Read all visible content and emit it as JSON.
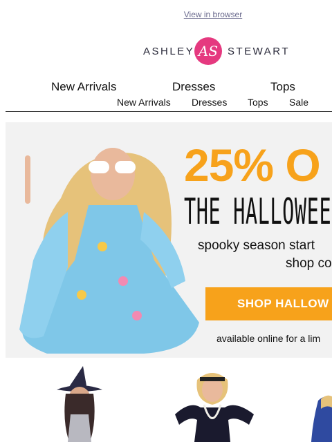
{
  "header": {
    "view_in_browser": "View in browser"
  },
  "logo": {
    "left_word": "ASHLEY",
    "right_word": "STEWART",
    "monogram": "AS",
    "brand_color": "#e5397f"
  },
  "nav_primary": [
    {
      "label": "New Arrivals"
    },
    {
      "label": "Dresses"
    },
    {
      "label": "Tops"
    }
  ],
  "nav_secondary": [
    {
      "label": "New Arrivals"
    },
    {
      "label": "Dresses"
    },
    {
      "label": "Tops"
    },
    {
      "label": "Sale"
    }
  ],
  "hero": {
    "headline": "25% O",
    "title": "THE HALLOWEEN",
    "line1": "spooky season start",
    "line2": "shop co",
    "cta_label": "SHOP HALLOW",
    "availability": "available online for a lim",
    "accent_color": "#f7a21b"
  },
  "products": [
    {
      "icon": "witch-costume-icon"
    },
    {
      "icon": "flapper-costume-icon"
    },
    {
      "icon": "costume-icon"
    }
  ]
}
